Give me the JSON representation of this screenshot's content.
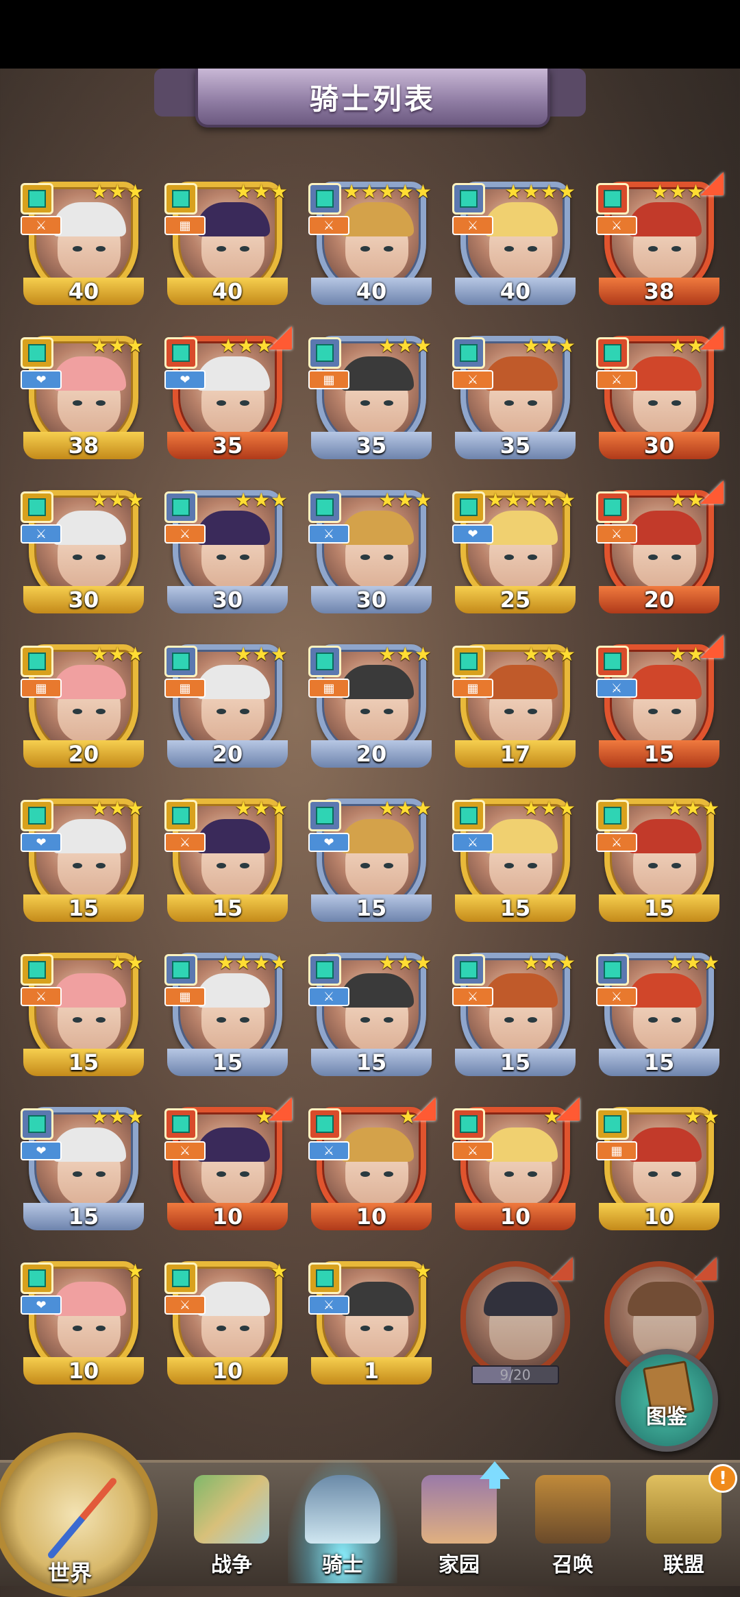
{
  "title": "骑士列表",
  "knights": [
    {
      "level": "40",
      "stars": 3,
      "frame": "gold",
      "role": "sword"
    },
    {
      "level": "40",
      "stars": 3,
      "frame": "gold",
      "role": "grid"
    },
    {
      "level": "40",
      "stars": 5,
      "frame": "blue",
      "role": "sword"
    },
    {
      "level": "40",
      "stars": 4,
      "frame": "blue",
      "role": "sword"
    },
    {
      "level": "38",
      "stars": 3,
      "frame": "red",
      "role": "sword",
      "upgrade": true
    },
    {
      "level": "38",
      "stars": 3,
      "frame": "gold",
      "role": "heart"
    },
    {
      "level": "35",
      "stars": 3,
      "frame": "red",
      "role": "heart",
      "upgrade": true
    },
    {
      "level": "35",
      "stars": 3,
      "frame": "blue",
      "role": "grid"
    },
    {
      "level": "35",
      "stars": 3,
      "frame": "blue",
      "role": "sword"
    },
    {
      "level": "30",
      "stars": 2,
      "frame": "red",
      "role": "sword",
      "upgrade": true
    },
    {
      "level": "30",
      "stars": 3,
      "frame": "gold",
      "role": "ice"
    },
    {
      "level": "30",
      "stars": 3,
      "frame": "blue",
      "role": "sword"
    },
    {
      "level": "30",
      "stars": 3,
      "frame": "blue",
      "role": "ice"
    },
    {
      "level": "25",
      "stars": 5,
      "frame": "gold",
      "role": "heart"
    },
    {
      "level": "20",
      "stars": 2,
      "frame": "red",
      "role": "sword",
      "upgrade": true
    },
    {
      "level": "20",
      "stars": 3,
      "frame": "gold",
      "role": "grid"
    },
    {
      "level": "20",
      "stars": 3,
      "frame": "blue",
      "role": "grid"
    },
    {
      "level": "20",
      "stars": 3,
      "frame": "blue",
      "role": "grid"
    },
    {
      "level": "17",
      "stars": 3,
      "frame": "gold",
      "role": "grid"
    },
    {
      "level": "15",
      "stars": 2,
      "frame": "red",
      "role": "ice",
      "upgrade": true
    },
    {
      "level": "15",
      "stars": 3,
      "frame": "gold",
      "role": "heart"
    },
    {
      "level": "15",
      "stars": 3,
      "frame": "gold",
      "role": "sword"
    },
    {
      "level": "15",
      "stars": 3,
      "frame": "blue",
      "role": "heart"
    },
    {
      "level": "15",
      "stars": 3,
      "frame": "gold",
      "role": "ice"
    },
    {
      "level": "15",
      "stars": 3,
      "frame": "gold",
      "role": "sword"
    },
    {
      "level": "15",
      "stars": 2,
      "frame": "gold",
      "role": "sword"
    },
    {
      "level": "15",
      "stars": 4,
      "frame": "blue",
      "role": "grid"
    },
    {
      "level": "15",
      "stars": 3,
      "frame": "blue",
      "role": "ice"
    },
    {
      "level": "15",
      "stars": 3,
      "frame": "blue",
      "role": "sword"
    },
    {
      "level": "15",
      "stars": 3,
      "frame": "blue",
      "role": "sword"
    },
    {
      "level": "15",
      "stars": 3,
      "frame": "blue",
      "role": "heart"
    },
    {
      "level": "10",
      "stars": 1,
      "frame": "red",
      "role": "sword",
      "upgrade": true
    },
    {
      "level": "10",
      "stars": 1,
      "frame": "red",
      "role": "ice",
      "upgrade": true
    },
    {
      "level": "10",
      "stars": 1,
      "frame": "red",
      "role": "sword",
      "upgrade": true
    },
    {
      "level": "10",
      "stars": 2,
      "frame": "gold",
      "role": "grid"
    },
    {
      "level": "10",
      "stars": 1,
      "frame": "gold",
      "role": "heart"
    },
    {
      "level": "10",
      "stars": 1,
      "frame": "gold",
      "role": "sword"
    },
    {
      "level": "1",
      "stars": 1,
      "frame": "gold",
      "role": "ice"
    }
  ],
  "locked_knights": [
    {
      "shards": "9/20",
      "progress": 0.45
    },
    {
      "shards": "",
      "progress": 0
    }
  ],
  "codex_label": "图鉴",
  "nav": {
    "world": "世界",
    "war": "战争",
    "knight": "骑士",
    "home": "家园",
    "summon": "召唤",
    "alliance": "联盟"
  },
  "alert": "!",
  "hair_colors": [
    "#e8e8e8",
    "#3a2a5a",
    "#d4a24a",
    "#f0d070",
    "#c23a2a",
    "#f0a0a0",
    "#e8e8e8",
    "#3a3a3a",
    "#c05a2a",
    "#d0462a"
  ]
}
